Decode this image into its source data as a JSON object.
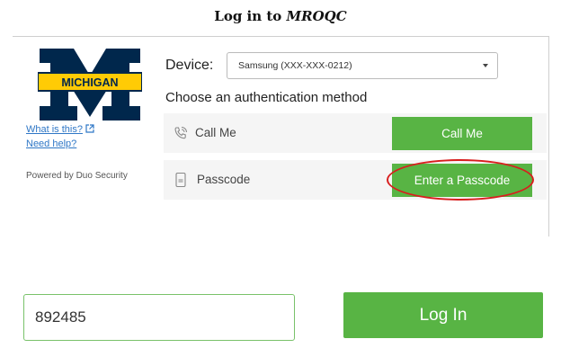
{
  "page": {
    "title_prefix": "Log in to",
    "title_app": "MROQC"
  },
  "duo": {
    "logo": {
      "icon": "michigan-block-m-logo",
      "text": "MICHIGAN",
      "colors": {
        "navy": "#00274c",
        "maize": "#ffcb05"
      }
    },
    "links": {
      "what_is_this": "What is this?",
      "need_help": "Need help?",
      "powered_by": "Powered by Duo Security"
    },
    "device": {
      "label": "Device:",
      "selected": "Samsung (XXX-XXX-0212)"
    },
    "choose_method": "Choose an authentication method",
    "methods": [
      {
        "icon": "phone-ringing-icon",
        "label": "Call Me",
        "button": "Call Me"
      },
      {
        "icon": "passcode-phone-icon",
        "label": "Passcode",
        "button": "Enter a Passcode"
      }
    ],
    "colors": {
      "accent": "#58b444",
      "highlight": "#d81e1e",
      "link": "#2f77c6"
    }
  },
  "login": {
    "passcode_value": "892485",
    "button_label": "Log In"
  }
}
